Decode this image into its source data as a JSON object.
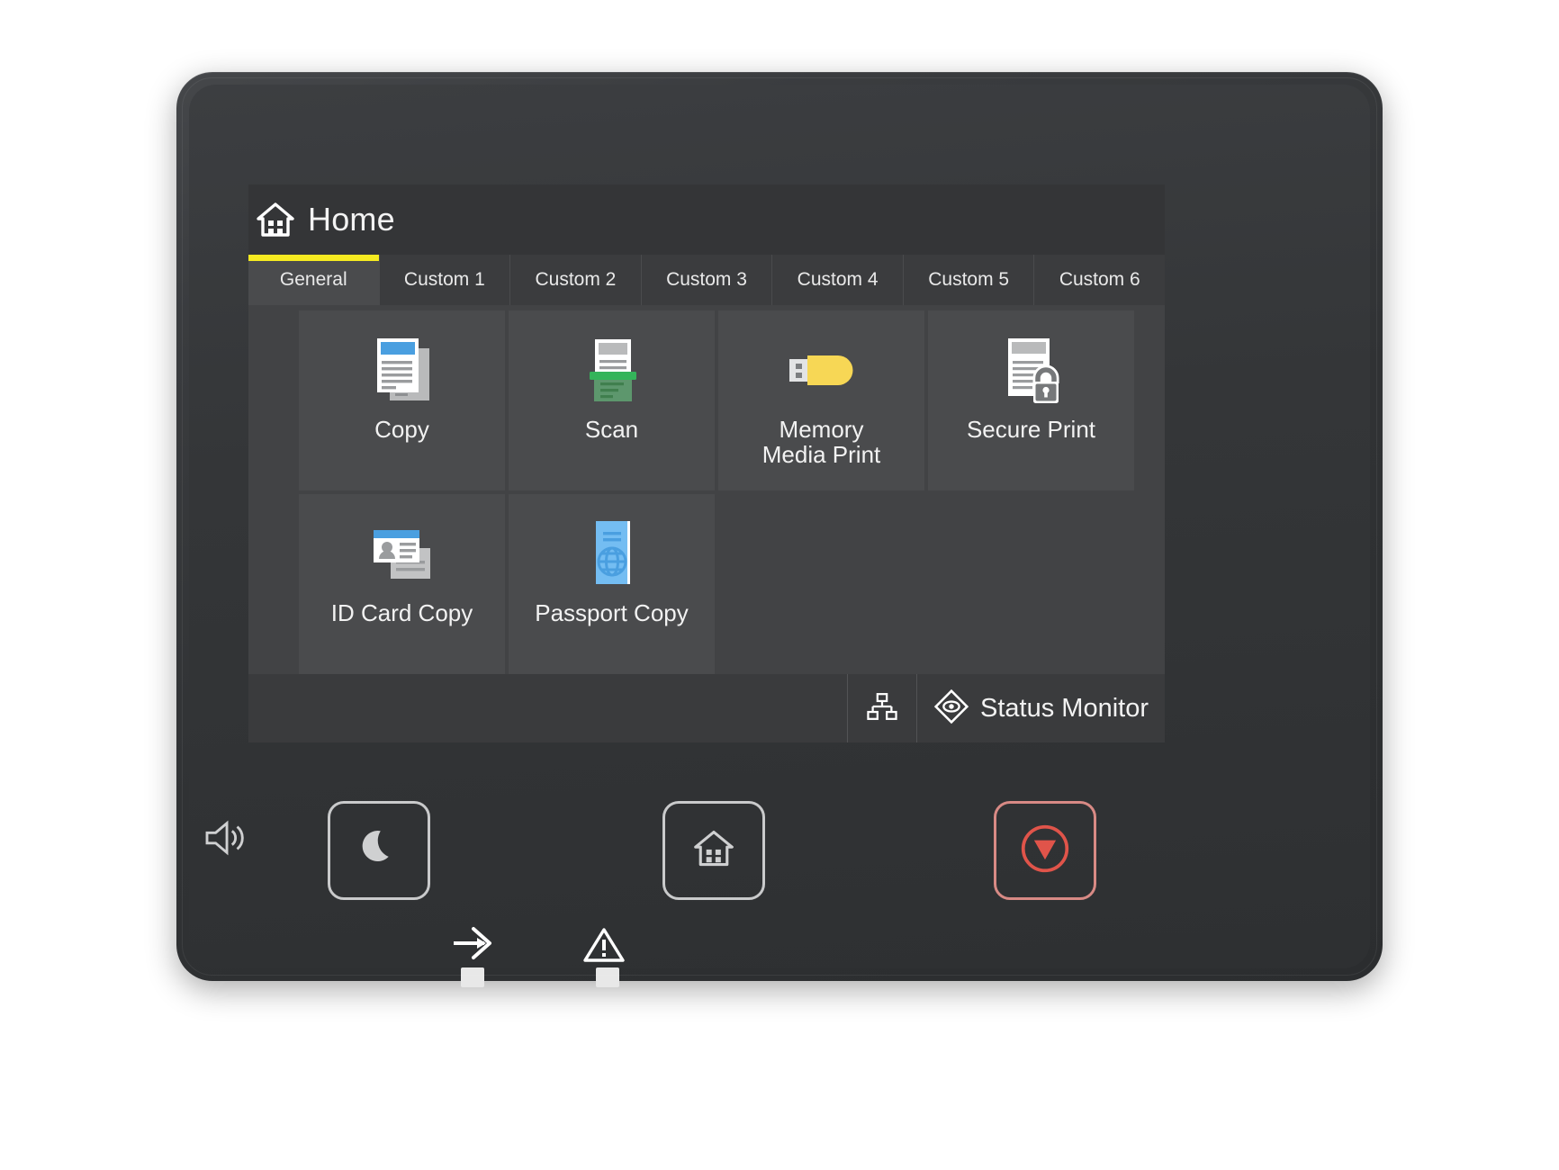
{
  "device": {
    "name": "printer-control-panel"
  },
  "screen": {
    "header": {
      "title": "Home",
      "icon": "home-icon"
    },
    "tabs": [
      {
        "label": "General",
        "active": true
      },
      {
        "label": "Custom 1",
        "active": false
      },
      {
        "label": "Custom 2",
        "active": false
      },
      {
        "label": "Custom 3",
        "active": false
      },
      {
        "label": "Custom 4",
        "active": false
      },
      {
        "label": "Custom 5",
        "active": false
      },
      {
        "label": "Custom 6",
        "active": false
      }
    ],
    "tiles": [
      {
        "label": "Copy",
        "icon": "copy-documents-icon"
      },
      {
        "label": "Scan",
        "icon": "scanner-icon"
      },
      {
        "label": "Memory\nMedia Print",
        "line1": "Memory",
        "line2": "Media Print",
        "icon": "usb-drive-icon"
      },
      {
        "label": "Secure Print",
        "icon": "document-lock-icon"
      },
      {
        "label": "ID Card Copy",
        "icon": "id-card-icon"
      },
      {
        "label": "Passport Copy",
        "icon": "passport-globe-icon"
      }
    ],
    "status_bar": {
      "lan_icon": "network-lan-icon",
      "status_monitor_icon": "eye-diamond-icon",
      "status_monitor_label": "Status Monitor"
    }
  },
  "hardware": {
    "speaker_icon": "speaker-volume-icon",
    "buttons": [
      {
        "name": "sleep-button",
        "icon": "moon-icon"
      },
      {
        "name": "home-button",
        "icon": "home-icon"
      },
      {
        "name": "stop-button",
        "icon": "stop-circle-icon"
      }
    ],
    "indicators": [
      {
        "name": "data-indicator",
        "icon": "data-arrow-icon"
      },
      {
        "name": "error-indicator",
        "icon": "warning-triangle-icon"
      }
    ]
  },
  "colors": {
    "accent_yellow": "#f5ea20",
    "stop_red": "#e0544a",
    "tile_bg": "#4a4b4d",
    "screen_bg": "#333436",
    "bezel": "#303234",
    "copy_blue": "#4a9fe0",
    "scan_green": "#34b45a",
    "usb_yellow": "#f7d755",
    "passport_blue": "#74bdf2"
  }
}
